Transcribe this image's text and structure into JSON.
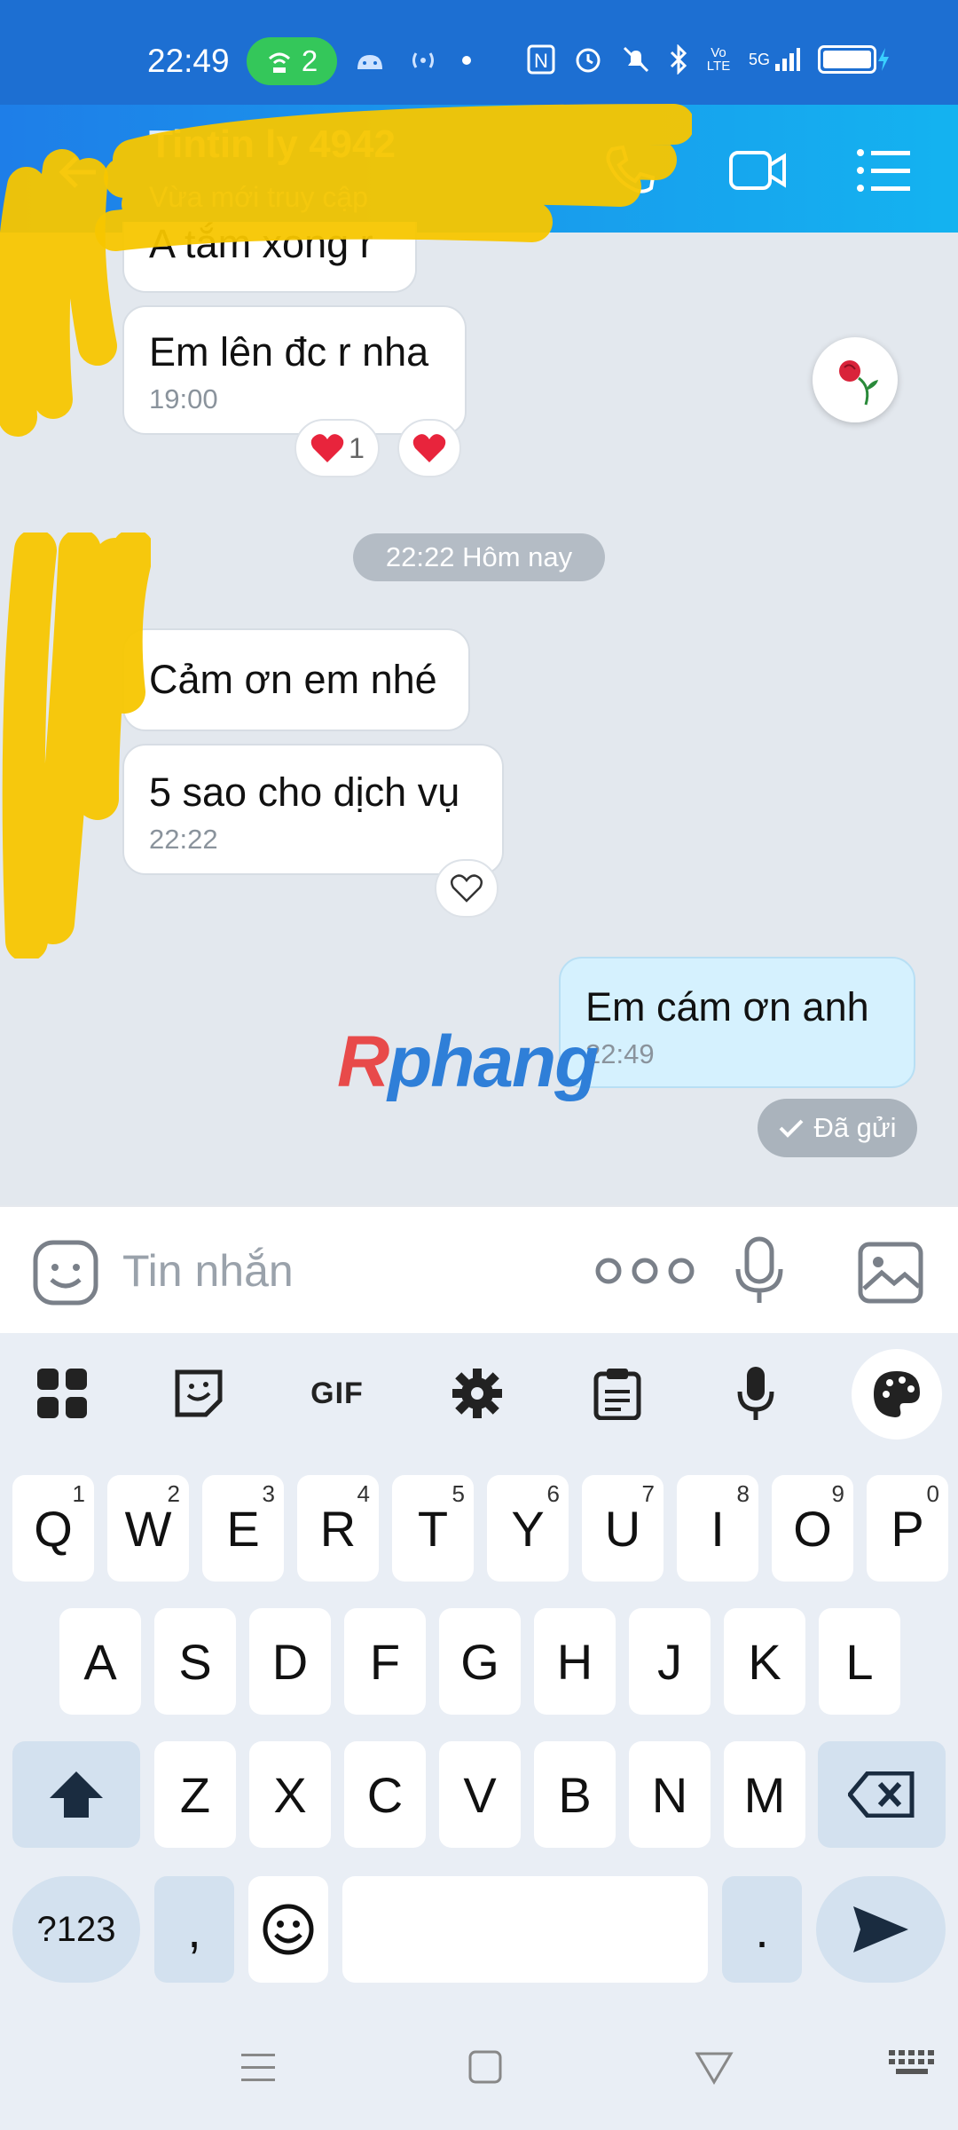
{
  "status_bar": {
    "time": "22:49",
    "hotspot_count": "2",
    "network": "5G",
    "volte": "Vo LTE"
  },
  "header": {
    "contact_name": "Tintin ly 4942",
    "contact_status": "Vừa mới truy cập"
  },
  "messages": [
    {
      "text": "A tắm xong r",
      "time": ""
    },
    {
      "text": "Em lên đc r nha",
      "time": "19:00",
      "reaction_count": "1"
    },
    {
      "text": "Cảm ơn em nhé",
      "time": ""
    },
    {
      "text": "5 sao cho dịch vụ",
      "time": "22:22"
    },
    {
      "text": "Em cám ơn anh",
      "time": "22:49"
    }
  ],
  "date_separator": "22:22 Hôm nay",
  "sent_status": "Đã gửi",
  "watermark": {
    "part1": "R",
    "part2": "phang"
  },
  "input": {
    "placeholder": "Tin nhắn"
  },
  "keyboard": {
    "gif_label": "GIF",
    "row1": [
      {
        "k": "Q",
        "h": "1"
      },
      {
        "k": "W",
        "h": "2"
      },
      {
        "k": "E",
        "h": "3"
      },
      {
        "k": "R",
        "h": "4"
      },
      {
        "k": "T",
        "h": "5"
      },
      {
        "k": "Y",
        "h": "6"
      },
      {
        "k": "U",
        "h": "7"
      },
      {
        "k": "I",
        "h": "8"
      },
      {
        "k": "O",
        "h": "9"
      },
      {
        "k": "P",
        "h": "0"
      }
    ],
    "row2": [
      "A",
      "S",
      "D",
      "F",
      "G",
      "H",
      "J",
      "K",
      "L"
    ],
    "row3": [
      "Z",
      "X",
      "C",
      "V",
      "B",
      "N",
      "M"
    ],
    "symbols_label": "?123",
    "comma": ",",
    "period": "."
  },
  "colors": {
    "header_start": "#1e7ee8",
    "header_end": "#14b3f0",
    "my_bubble": "#d5f1fe",
    "heart": "#e8243c",
    "hotspot": "#34c75a"
  }
}
